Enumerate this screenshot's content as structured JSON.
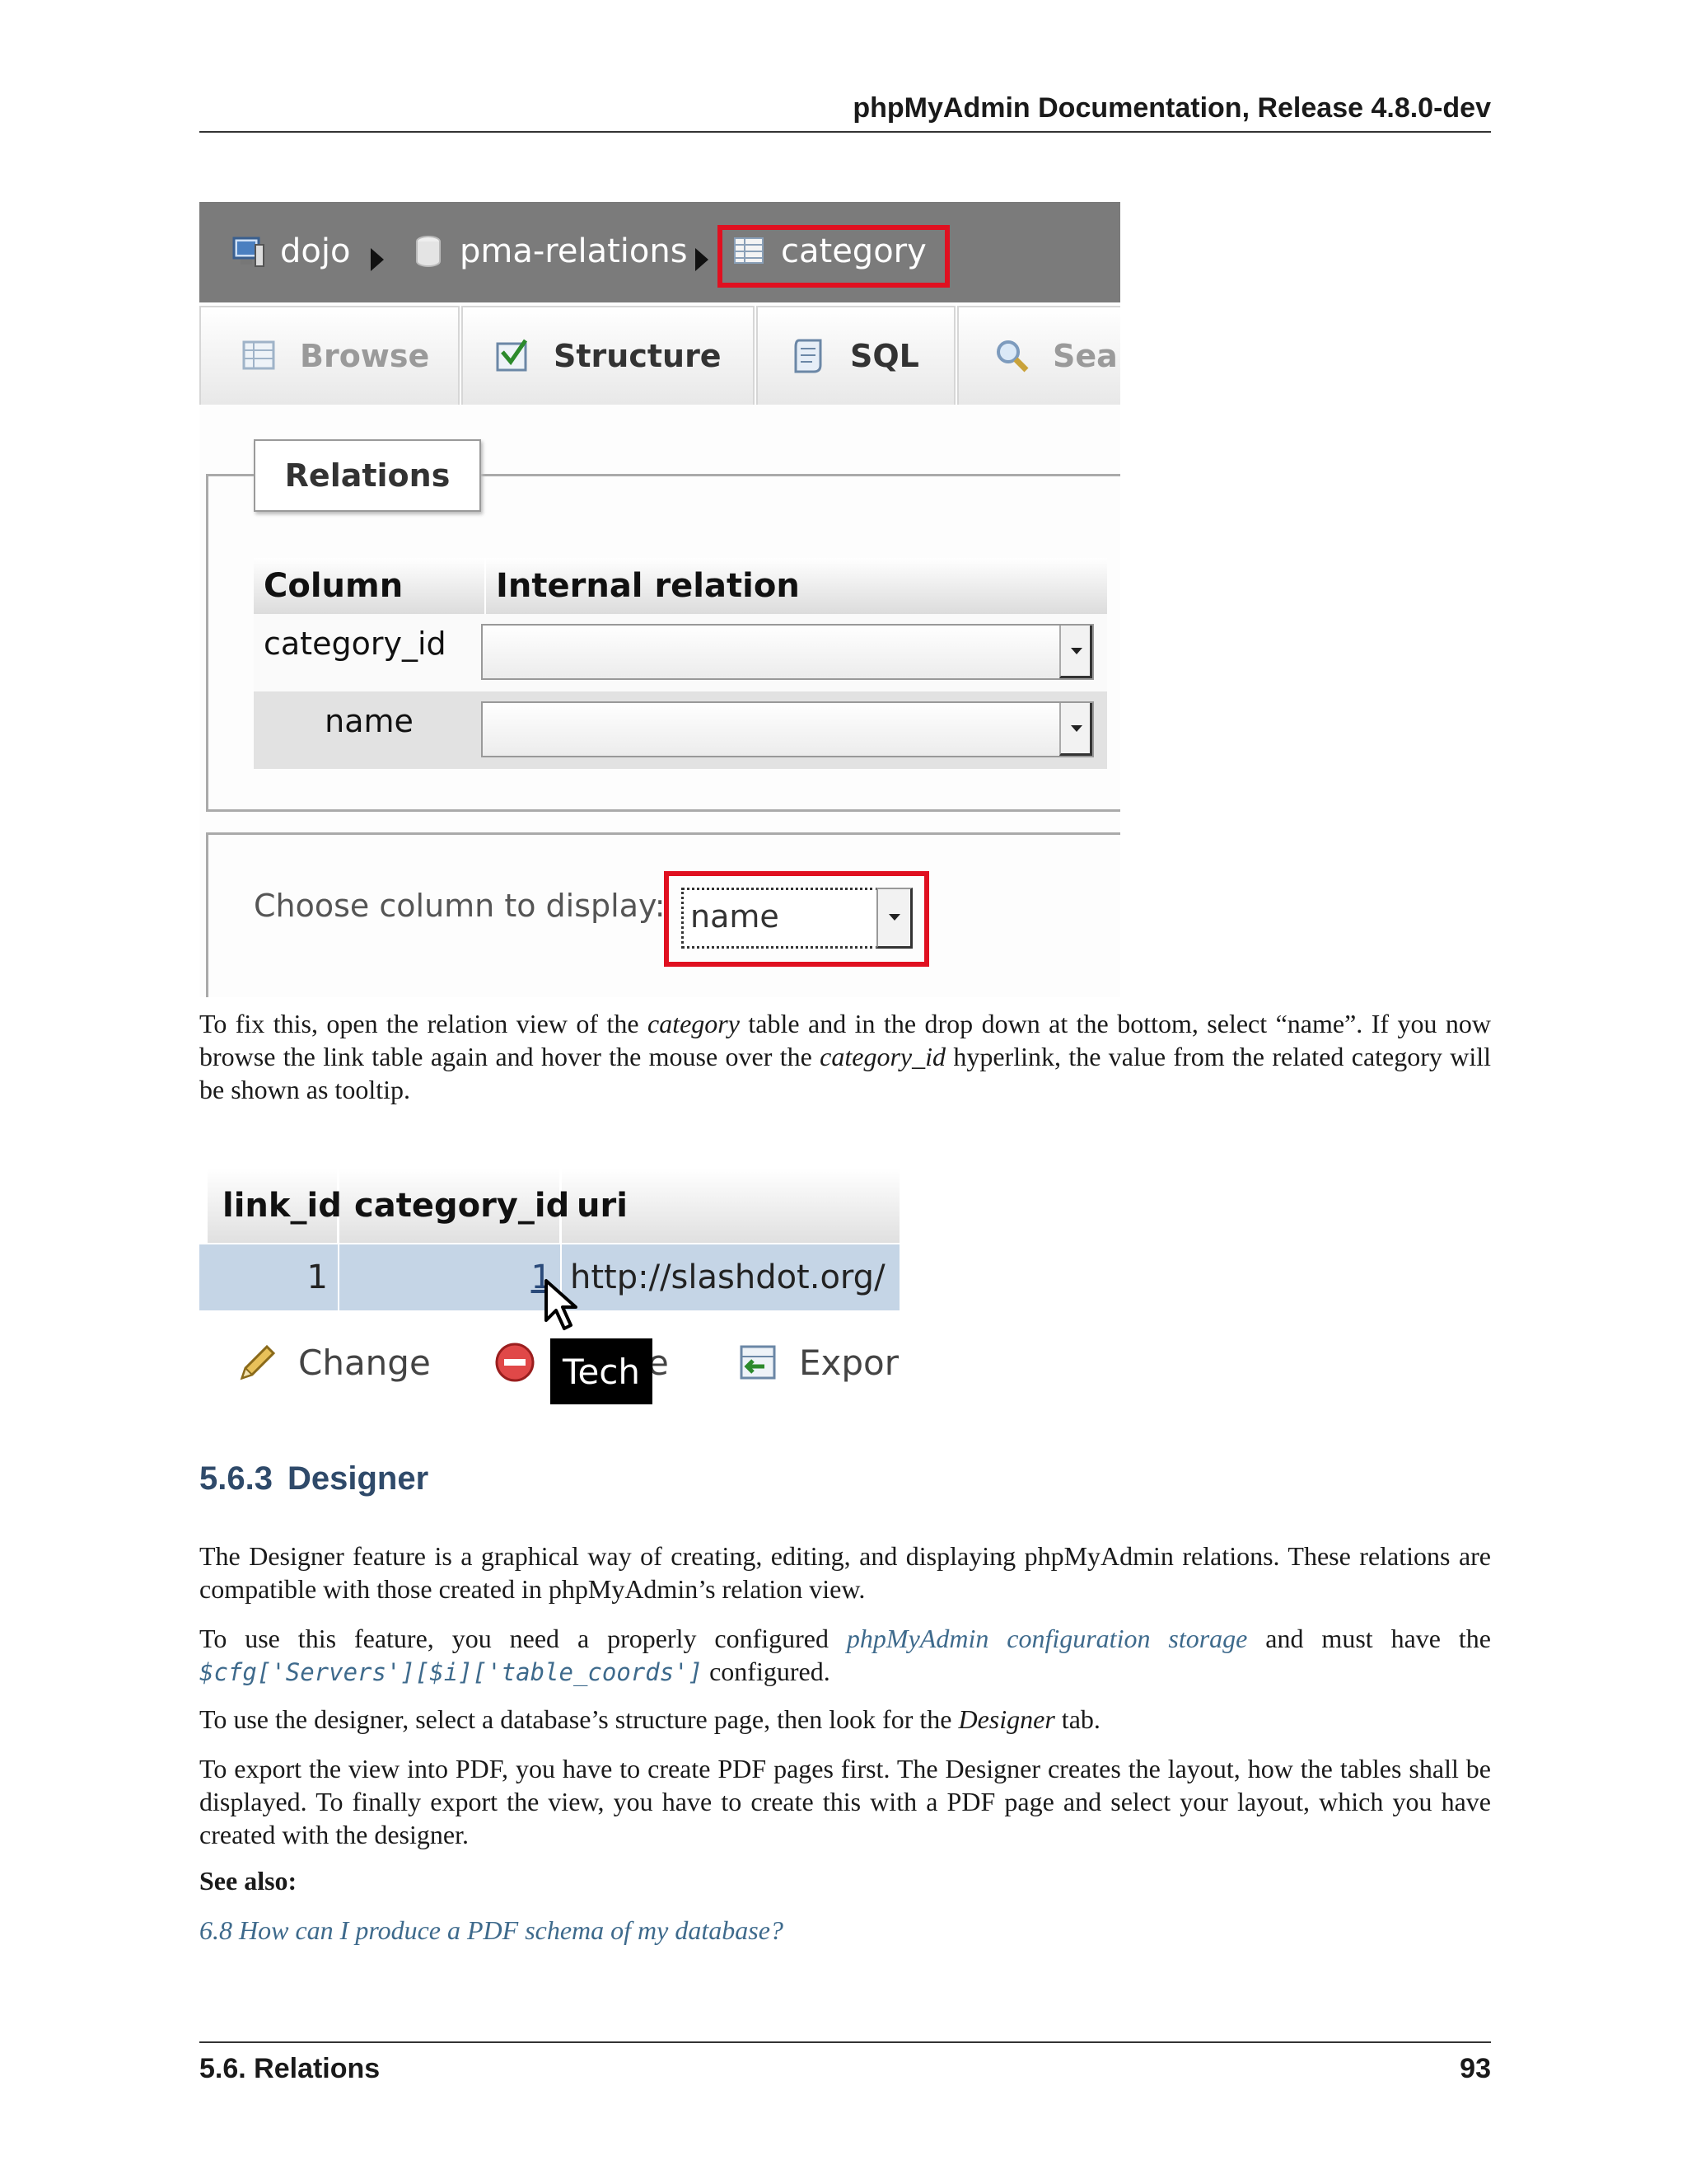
{
  "header": {
    "running_title": "phpMyAdmin Documentation, Release 4.8.0-dev"
  },
  "screenshot_relations": {
    "breadcrumb": [
      {
        "label": "dojo",
        "icon": "server-icon"
      },
      {
        "label": "pma-relations",
        "icon": "database-icon"
      },
      {
        "label": "category",
        "icon": "table-icon"
      }
    ],
    "tabs": [
      {
        "label": "Browse",
        "icon": "browse-icon"
      },
      {
        "label": "Structure",
        "icon": "structure-icon"
      },
      {
        "label": "SQL",
        "icon": "sql-icon"
      },
      {
        "label": "Sea",
        "icon": "search-icon"
      }
    ],
    "legend": "Relations",
    "table": {
      "headers": [
        "Column",
        "Internal relation"
      ],
      "rows": [
        {
          "column": "category_id",
          "relation": ""
        },
        {
          "column": "name",
          "relation": ""
        }
      ]
    },
    "display_label": "Choose column to display:",
    "display_value": "name"
  },
  "para1": {
    "t1": "To fix this, open the relation view of the ",
    "e1": "category",
    "t2": " table and in the drop down at the bottom, select “name”. If you now browse the link table again and hover the mouse over the ",
    "e2": "category_id",
    "t3": " hyperlink, the value from the related category will be shown as tooltip."
  },
  "screenshot_link": {
    "headers": [
      "link_id",
      "category_id",
      "uri"
    ],
    "row": {
      "link_id": "1",
      "category_id": "1",
      "uri": "http://slashdot.org/"
    },
    "actions": [
      {
        "label": "Change",
        "icon": "pencil-icon"
      },
      {
        "label": "Delete",
        "icon": "delete-icon",
        "visible_fragment": "e"
      },
      {
        "label": "Export",
        "icon": "export-icon"
      }
    ],
    "tooltip": "Tech"
  },
  "section": {
    "number": "5.6.3",
    "title": "Designer"
  },
  "para2": "The Designer feature is a graphical way of creating, editing, and displaying phpMyAdmin relations. These relations are compatible with those created in phpMyAdmin’s relation view.",
  "para3": {
    "t1": "To use this feature, you need a properly configured ",
    "link": "phpMyAdmin configuration storage",
    "t2": " and must have the ",
    "code": "$cfg['Servers'][$i]['table_coords']",
    "t3": " configured."
  },
  "para4": {
    "t1": "To use the designer, select a database’s structure page, then look for the ",
    "em": "Designer",
    "t2": " tab."
  },
  "para5": "To export the view into PDF, you have to create PDF pages first. The Designer creates the layout, how the tables shall be displayed. To finally export the view, you have to create this with a PDF page and select your layout, which you have created with the designer.",
  "see_also": {
    "label": "See also:",
    "link": "6.8 How can I produce a PDF schema of my database?"
  },
  "footer": {
    "section": "5.6.  Relations",
    "page": "93"
  },
  "colors": {
    "accent_link": "#3e6a8c",
    "heading": "#2f4a6a",
    "highlight_box": "#e01020",
    "selected_row": "#c5d5e6"
  }
}
